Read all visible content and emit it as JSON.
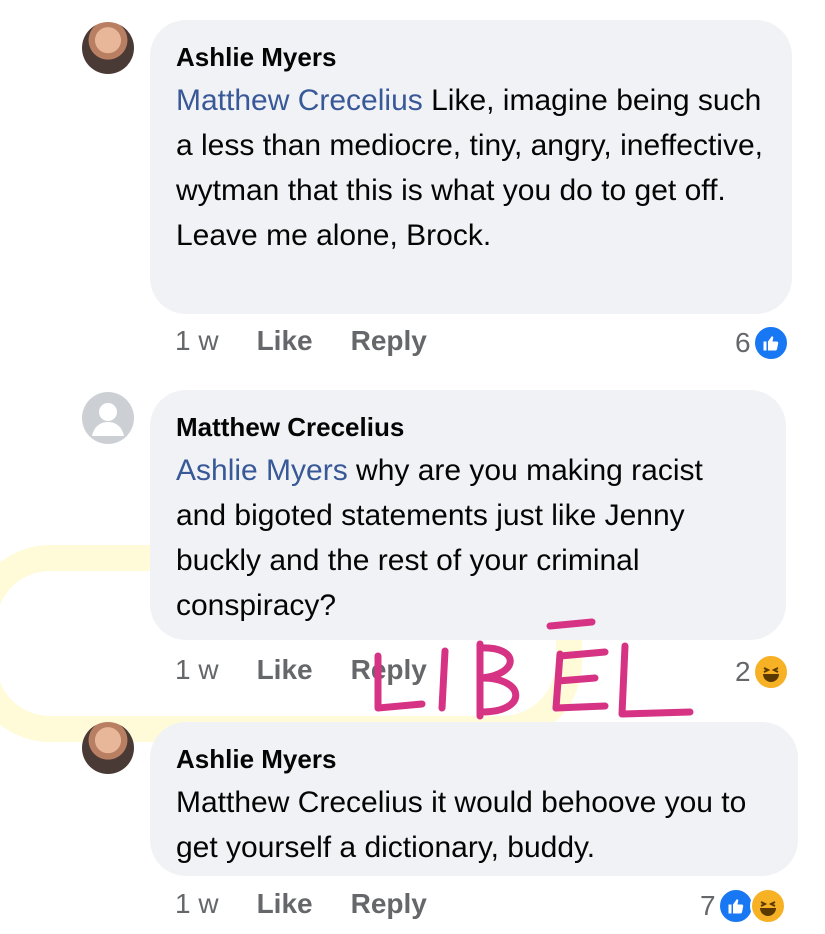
{
  "comments": [
    {
      "author": "Ashlie Myers",
      "mention": "Matthew Crecelius",
      "body": " Like, imagine being such a less than mediocre, tiny, angry, ineffective, wytman that this is what you do to get off.  Leave me alone, Brock.",
      "time": "1 w",
      "like_label": "Like",
      "reply_label": "Reply",
      "reaction_count": "6",
      "reactions": [
        "like-icon"
      ],
      "avatar": "photo"
    },
    {
      "author": "Matthew Crecelius",
      "mention": "Ashlie Myers",
      "body": " why are you making racist and bigoted statements just like Jenny buckly and the rest of your criminal conspiracy?",
      "time": "1 w",
      "like_label": "Like",
      "reply_label": "Reply",
      "reaction_count": "2",
      "reactions": [
        "haha-icon"
      ],
      "avatar": "default"
    },
    {
      "author": "Ashlie Myers",
      "mention": "",
      "body": "Matthew Crecelius it would behoove you to get yourself a dictionary, buddy.",
      "time": "1 w",
      "like_label": "Like",
      "reply_label": "Reply",
      "reaction_count": "7",
      "reactions": [
        "like-icon",
        "haha-icon"
      ],
      "avatar": "photo"
    }
  ],
  "annotation": {
    "handwritten_text": "LIBEL",
    "color": "#d63384"
  },
  "colors": {
    "mention": "#385898",
    "bubble": "#f0f2f5",
    "meta": "#65676b",
    "like": "#1877f2",
    "haha": "#f7b125"
  }
}
